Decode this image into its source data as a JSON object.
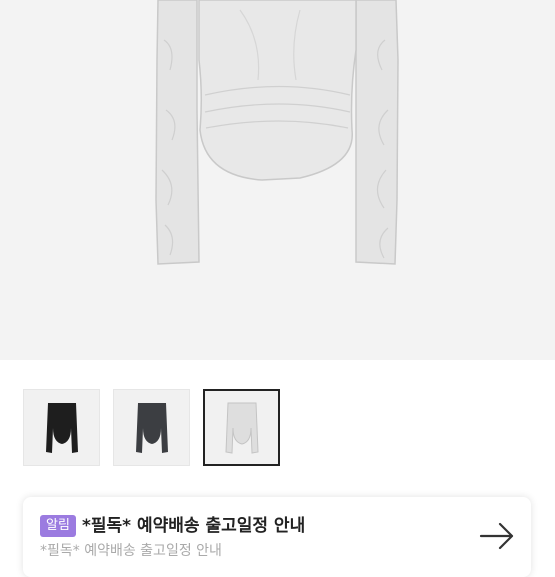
{
  "product": {
    "main_image": "long-sleeve-ruched-top-white-photo",
    "thumbnails": [
      {
        "name": "black-top-thumbnail",
        "color": "#1e1e1e"
      },
      {
        "name": "charcoal-top-thumbnail",
        "color": "#3c3e42"
      },
      {
        "name": "white-top-thumbnail",
        "color": "#dedede",
        "selected": true
      }
    ]
  },
  "notice": {
    "badge": "알림",
    "title": "*필독* 예약배송 출고일정 안내",
    "subtitle": "*필독* 예약배송 출고일정 안내",
    "arrow_icon": "arrow-right-icon"
  },
  "colors": {
    "accent": "#9b7be0",
    "hero_background": "#f3f3f3"
  }
}
